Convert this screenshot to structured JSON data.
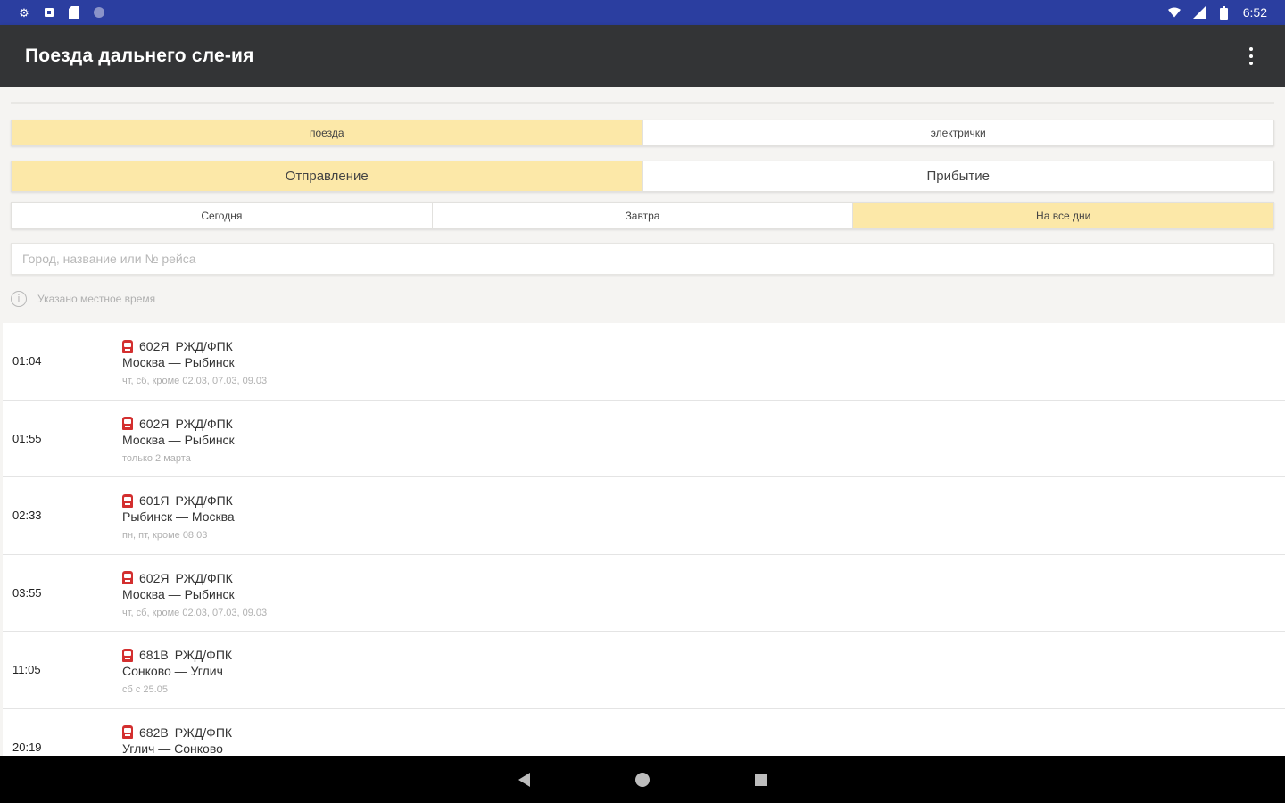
{
  "statusbar": {
    "left_icons": [
      "settings-icon",
      "notification-icon",
      "sd-card-icon",
      "circle-app-icon"
    ],
    "time": "6:52"
  },
  "appbar": {
    "title": "Поезда дальнего сле-ия"
  },
  "filters": {
    "transport": {
      "options": [
        "поезда",
        "электрички"
      ],
      "selected": 0
    },
    "direction": {
      "options": [
        "Отправление",
        "Прибытие"
      ],
      "selected": 0
    },
    "day": {
      "options": [
        "Сегодня",
        "Завтра",
        "На все дни"
      ],
      "selected": 2
    }
  },
  "search": {
    "value": "",
    "placeholder": "Город, название или № рейса"
  },
  "note": "Указано местное время",
  "trains": [
    {
      "time": "01:04",
      "number": "602Я",
      "carrier": "РЖД/ФПК",
      "route": "Москва — Рыбинск",
      "days": "чт, сб, кроме 02.03, 07.03, 09.03"
    },
    {
      "time": "01:55",
      "number": "602Я",
      "carrier": "РЖД/ФПК",
      "route": "Москва — Рыбинск",
      "days": "только 2 марта"
    },
    {
      "time": "02:33",
      "number": "601Я",
      "carrier": "РЖД/ФПК",
      "route": "Рыбинск — Москва",
      "days": "пн, пт, кроме 08.03"
    },
    {
      "time": "03:55",
      "number": "602Я",
      "carrier": "РЖД/ФПК",
      "route": "Москва — Рыбинск",
      "days": "чт, сб, кроме 02.03, 07.03, 09.03"
    },
    {
      "time": "11:05",
      "number": "681В",
      "carrier": "РЖД/ФПК",
      "route": "Сонково — Углич",
      "days": "сб с 25.05"
    },
    {
      "time": "20:19",
      "number": "682В",
      "carrier": "РЖД/ФПК",
      "route": "Углич — Сонково",
      "days": ""
    }
  ],
  "colors": {
    "statusbar": "#2b3ea0",
    "appbar": "#333436",
    "active_segment": "#fce8a8",
    "train_icon": "#d32f2f"
  },
  "navbar": {
    "buttons": [
      "back-icon",
      "home-icon",
      "recents-icon"
    ]
  }
}
